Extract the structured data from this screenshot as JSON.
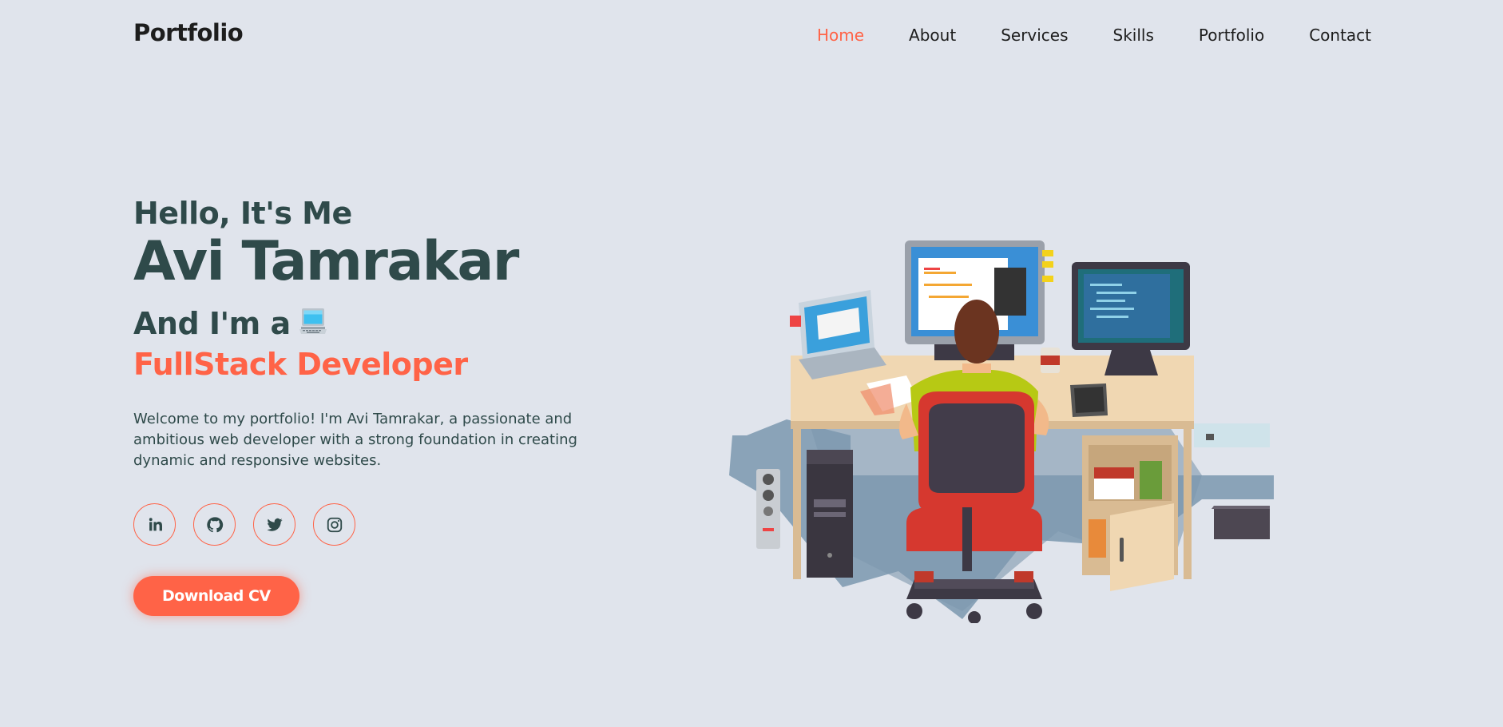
{
  "nav": {
    "logo": "Portfolio",
    "items": [
      {
        "label": "Home",
        "active": true
      },
      {
        "label": "About"
      },
      {
        "label": "Services"
      },
      {
        "label": "Skills"
      },
      {
        "label": "Portfolio"
      },
      {
        "label": "Contact"
      }
    ]
  },
  "hero": {
    "greeting": "Hello, It's Me",
    "name": "Avi Tamrakar",
    "role_prefix": "And I'm a",
    "role_icon": "laptop-emoji",
    "role_highlight": "FullStack Developer",
    "intro": "Welcome to my portfolio! I'm Avi Tamrakar, a passionate and ambitious web developer with a strong foundation in creating dynamic and responsive websites.",
    "socials": [
      {
        "icon": "linkedin-icon"
      },
      {
        "icon": "github-icon"
      },
      {
        "icon": "twitter-icon"
      },
      {
        "icon": "instagram-icon"
      }
    ],
    "cv_button": "Download CV"
  },
  "colors": {
    "accent": "#ff6347",
    "background": "#e0e4ec",
    "text": "#2f4a4a"
  }
}
